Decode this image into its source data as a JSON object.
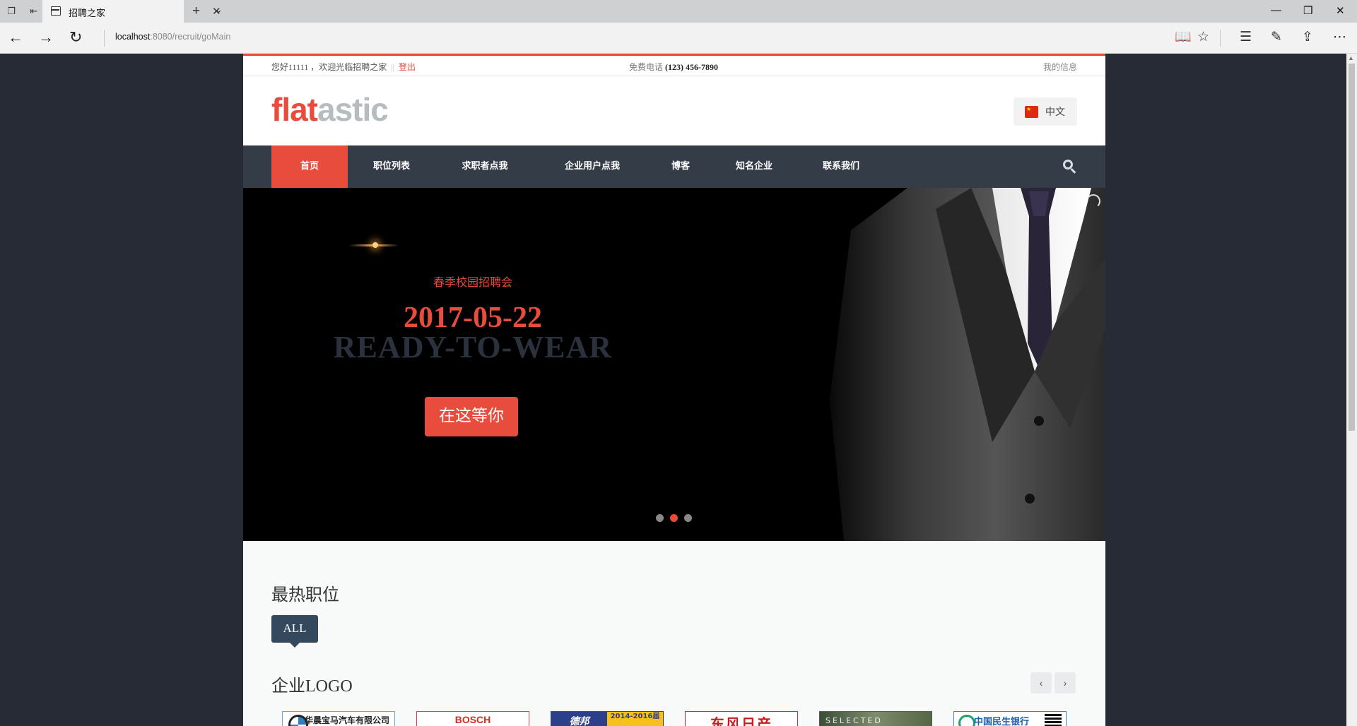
{
  "browser": {
    "tab_title": "招聘之家",
    "url_host": "localhost",
    "url_rest": ":8080/recruit/goMain"
  },
  "topbar": {
    "welcome": "您好11111 ，欢迎光临招聘之家",
    "separator": "||",
    "logout": "登出",
    "phone_label": "免费电话",
    "phone_number": "(123) 456-7890",
    "my_info": "我的信息"
  },
  "header": {
    "logo_part1": "flat",
    "logo_part2": "astic",
    "language": "中文"
  },
  "nav": {
    "items": [
      "首页",
      "职位列表",
      "求职者点我",
      "企业用户点我",
      "博客",
      "知名企业",
      "联系我们"
    ],
    "active_index": 0
  },
  "hero": {
    "subtitle": "春季校园招聘会",
    "date": "2017-05-22",
    "title": "READY-TO-WEAR",
    "button": "在这等你",
    "slide_count": 3,
    "active_slide": 1
  },
  "hot_jobs": {
    "title": "最热职位",
    "filter_label": "ALL"
  },
  "company_logos": {
    "title": "企业LOGO",
    "prev": "‹",
    "next": "›",
    "logos": [
      {
        "name": "bmw",
        "text": "华晨宝马汽车有限公司"
      },
      {
        "name": "bosch",
        "text": "BOSCH"
      },
      {
        "name": "debang",
        "text": "德邦",
        "text2": "2014-2016届"
      },
      {
        "name": "dongfeng-nissan",
        "text": "东风日产"
      },
      {
        "name": "selected",
        "text": "SELECTED"
      },
      {
        "name": "cmbc",
        "text": "中国民生银行"
      }
    ]
  },
  "colors": {
    "accent": "#e74c3c",
    "nav_bg": "#343c48",
    "page_bg": "#262b35"
  }
}
